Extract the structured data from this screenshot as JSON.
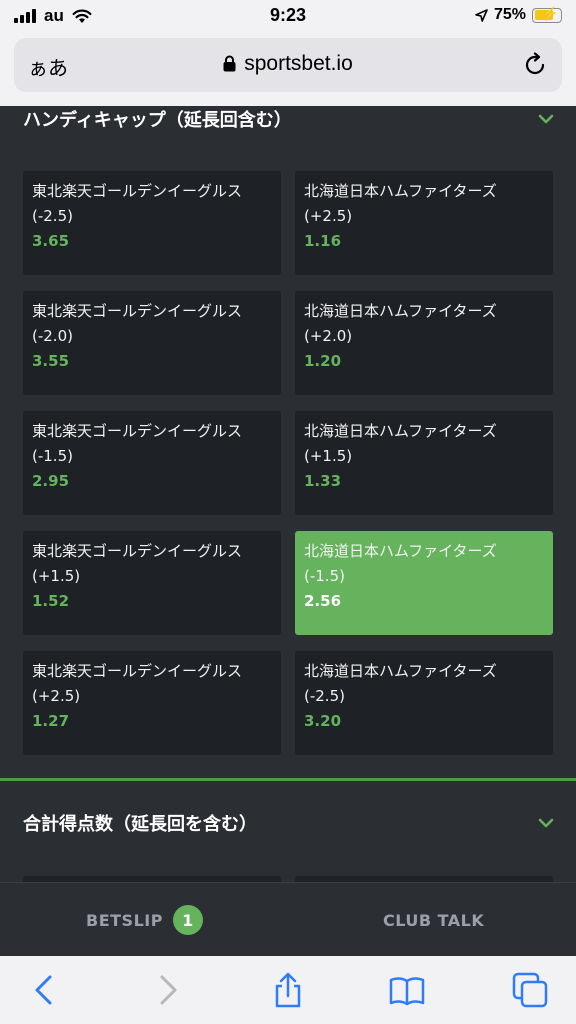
{
  "status_bar": {
    "carrier": "au",
    "time": "9:23",
    "battery": "75%"
  },
  "browser": {
    "aa_label": "ぁあ",
    "url": "sportsbet.io"
  },
  "sections": [
    {
      "title": "ハンディキャップ（延長回含む）",
      "markets": [
        {
          "home": {
            "team": "東北楽天ゴールデンイーグルス",
            "line": "(-2.5)",
            "odds": "3.65"
          },
          "away": {
            "team": "北海道日本ハムファイターズ",
            "line": "(+2.5)",
            "odds": "1.16"
          }
        },
        {
          "home": {
            "team": "東北楽天ゴールデンイーグルス",
            "line": "(-2.0)",
            "odds": "3.55"
          },
          "away": {
            "team": "北海道日本ハムファイターズ",
            "line": "(+2.0)",
            "odds": "1.20"
          }
        },
        {
          "home": {
            "team": "東北楽天ゴールデンイーグルス",
            "line": "(-1.5)",
            "odds": "2.95"
          },
          "away": {
            "team": "北海道日本ハムファイターズ",
            "line": "(+1.5)",
            "odds": "1.33"
          }
        },
        {
          "home": {
            "team": "東北楽天ゴールデンイーグルス",
            "line": "(+1.5)",
            "odds": "1.52"
          },
          "away": {
            "team": "北海道日本ハムファイターズ",
            "line": "(-1.5)",
            "odds": "2.56",
            "selected": true
          }
        },
        {
          "home": {
            "team": "東北楽天ゴールデンイーグルス",
            "line": "(+2.5)",
            "odds": "1.27"
          },
          "away": {
            "team": "北海道日本ハムファイターズ",
            "line": "(-2.5)",
            "odds": "3.20"
          }
        }
      ]
    },
    {
      "title": "合計得点数（延長回を含む）"
    }
  ],
  "bottom_bar": {
    "betslip_label": "BETSLIP",
    "betslip_count": "1",
    "club_talk_label": "CLUB TALK"
  },
  "colors": {
    "accent": "#66b35e",
    "card_bg": "#1e2125",
    "page_bg": "#2b2e33"
  },
  "icons": [
    "signal-icon",
    "wifi-icon",
    "location-icon",
    "battery-icon",
    "lock-icon",
    "reload-icon",
    "chevron-down-icon",
    "back-icon",
    "forward-icon",
    "share-icon",
    "bookmarks-icon",
    "tabs-icon"
  ]
}
